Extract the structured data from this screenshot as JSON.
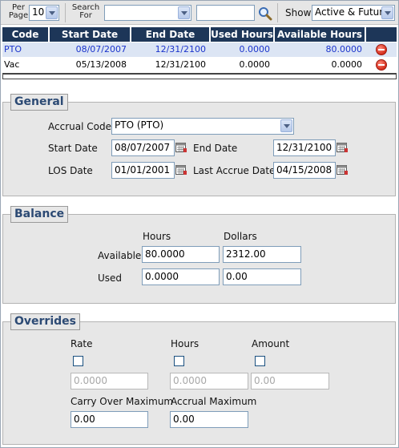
{
  "toolbar": {
    "per_page_label_1": "Per",
    "per_page_label_2": "Page",
    "per_page_value": "10",
    "search_label_1": "Search",
    "search_label_2": "For",
    "search_select_value": "",
    "search_text_value": "",
    "show_label": "Show",
    "show_value": "Active & Future"
  },
  "grid": {
    "columns": [
      "Code",
      "Start Date",
      "End Date",
      "Used Hours",
      "Available Hours"
    ],
    "rows": [
      {
        "code": "PTO",
        "start": "08/07/2007",
        "end": "12/31/2100",
        "used": "0.0000",
        "available": "80.0000",
        "selected": true
      },
      {
        "code": "Vac",
        "start": "05/13/2008",
        "end": "12/31/2100",
        "used": "0.0000",
        "available": "0.0000",
        "selected": false
      }
    ]
  },
  "general": {
    "title": "General",
    "accrual_code_label": "Accrual Code",
    "accrual_code_value": "PTO (PTO)",
    "start_date_label": "Start Date",
    "start_date_value": "08/07/2007",
    "end_date_label": "End Date",
    "end_date_value": "12/31/2100",
    "los_date_label": "LOS Date",
    "los_date_value": "01/01/2001",
    "last_accrue_label": "Last Accrue Date",
    "last_accrue_value": "04/15/2008"
  },
  "balance": {
    "title": "Balance",
    "hours_header": "Hours",
    "dollars_header": "Dollars",
    "available_label": "Available",
    "available_hours": "80.0000",
    "available_dollars": "2312.00",
    "used_label": "Used",
    "used_hours": "0.0000",
    "used_dollars": "0.00"
  },
  "overrides": {
    "title": "Overrides",
    "rate_label": "Rate",
    "hours_label": "Hours",
    "amount_label": "Amount",
    "rate_value": "0.0000",
    "hours_value": "0.0000",
    "amount_value": "0.00",
    "carry_over_label": "Carry Over Maximum",
    "carry_over_value": "0.00",
    "accrual_max_label": "Accrual Maximum",
    "accrual_max_value": "0.00"
  },
  "colors": {
    "grid_header": "#1d3658",
    "link_blue": "#1a33cc",
    "legend_text": "#2c4a74"
  },
  "icons": [
    "search-icon",
    "calendar-icon",
    "delete-icon",
    "chevron-down-icon"
  ]
}
